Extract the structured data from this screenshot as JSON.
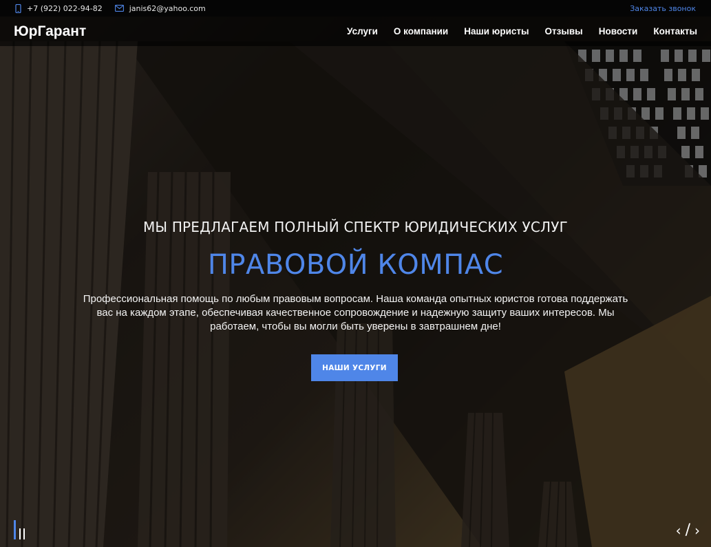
{
  "topbar": {
    "phone": "+7 (922) 022-94-82",
    "email": "janis62@yahoo.com",
    "callback_label": "Заказать звонок"
  },
  "navbar": {
    "logo": "ЮрГарант",
    "items": [
      {
        "label": "Услуги"
      },
      {
        "label": "О компании"
      },
      {
        "label": "Наши юристы"
      },
      {
        "label": "Отзывы"
      },
      {
        "label": "Новости"
      },
      {
        "label": "Контакты"
      }
    ]
  },
  "hero": {
    "subtitle": "МЫ ПРЕДЛАГАЕМ ПОЛНЫЙ СПЕКТР ЮРИДИЧЕСКИХ УСЛУГ",
    "title": "ПРАВОВОЙ КОМПАС",
    "description": "Профессиональная помощь по любым правовым вопросам. Наша команда опытных юристов готова поддержать вас на каждом этапе, обеспечивая качественное сопровождение и надежную защиту ваших интересов. Мы работаем, чтобы вы могли быть уверены в завтрашнем дне!",
    "cta_label": "НАШИ УСЛУГИ"
  },
  "slider": {
    "prev_icon": "chevron-left-icon",
    "next_icon": "chevron-right-icon",
    "pause_icon": "pause-icon"
  },
  "colors": {
    "accent": "#4f86e8",
    "topbar_bg": "#050505",
    "navbar_bg": "rgba(0,0,0,0.62)"
  }
}
